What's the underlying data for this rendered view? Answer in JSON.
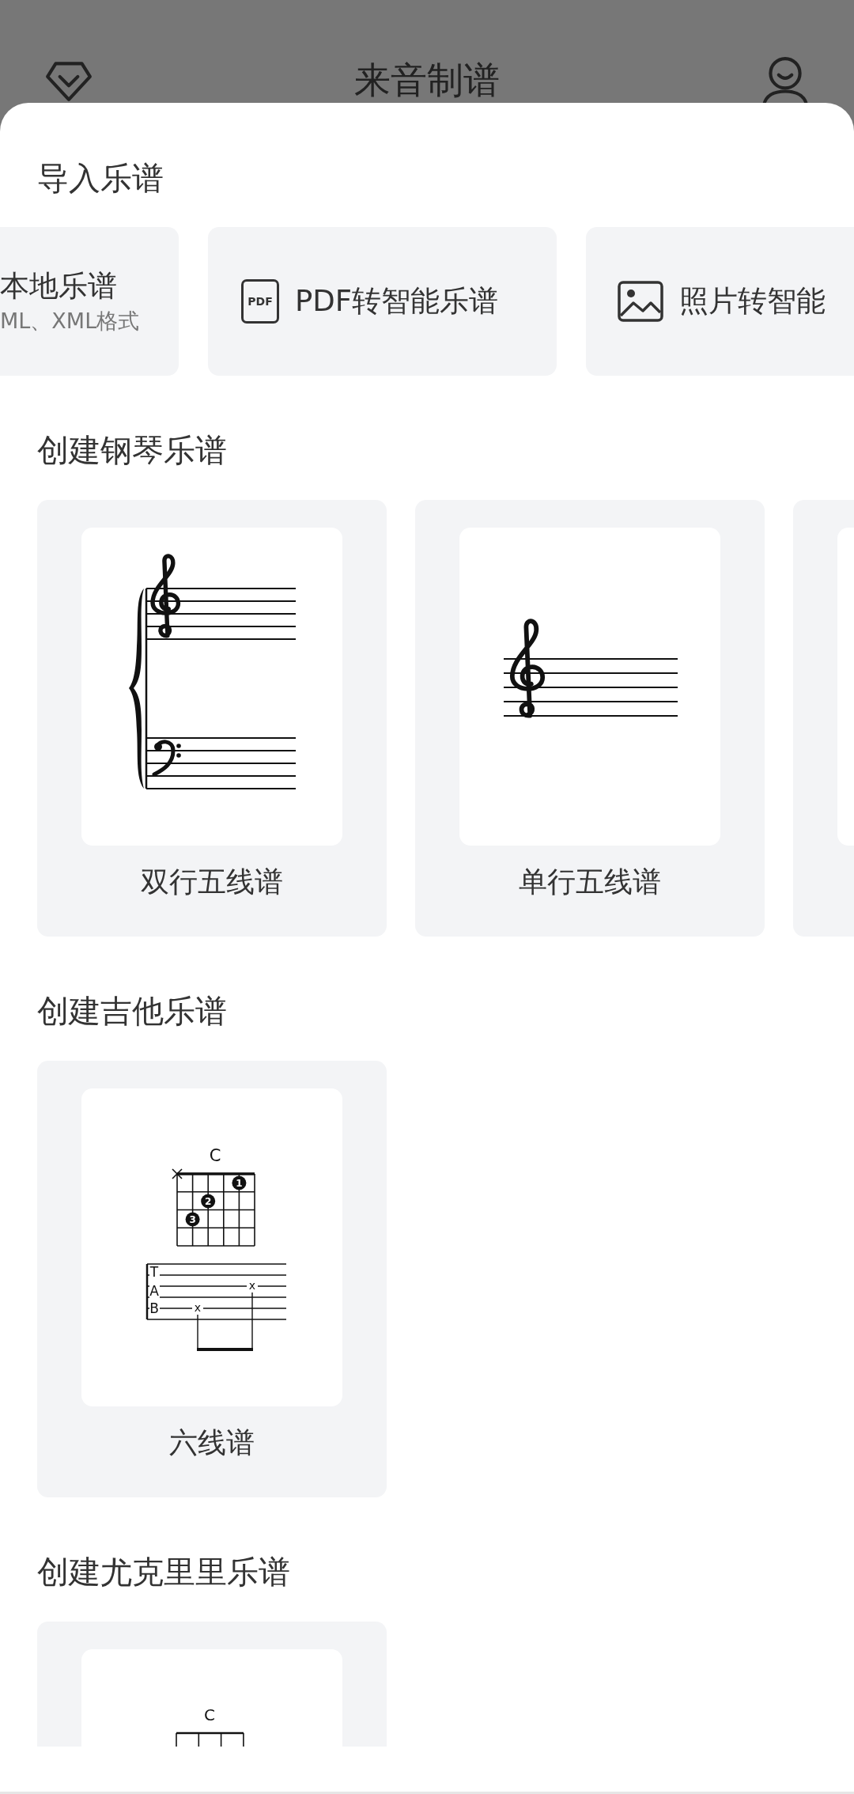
{
  "header": {
    "title": "来音制谱"
  },
  "sections": [
    {
      "kind": "import",
      "title": "导入乐谱",
      "items": [
        {
          "kind": "local",
          "title": "本地乐谱",
          "subtitle": "ML、XML格式"
        },
        {
          "kind": "pdf",
          "icon_text": "PDF",
          "title": "PDF转智能乐谱"
        },
        {
          "kind": "photo",
          "title": "照片转智能"
        }
      ]
    },
    {
      "kind": "templates",
      "title": "创建钢琴乐谱",
      "items": [
        {
          "kind": "grand-staff",
          "label": "双行五线谱"
        },
        {
          "kind": "treble-staff",
          "label": "单行五线谱"
        },
        {
          "kind": "hidden"
        }
      ]
    },
    {
      "kind": "templates",
      "title": "创建吉他乐谱",
      "items": [
        {
          "kind": "guitar-tab",
          "label": "六线谱",
          "chord": "C",
          "fingers": [
            "1",
            "2",
            "3"
          ],
          "tab_letters": [
            "T",
            "A",
            "B"
          ],
          "tab_marks": [
            "x",
            "x"
          ]
        }
      ]
    },
    {
      "kind": "templates",
      "title": "创建尤克里里乐谱",
      "items": [
        {
          "kind": "ukulele",
          "chord": "C"
        }
      ]
    }
  ]
}
